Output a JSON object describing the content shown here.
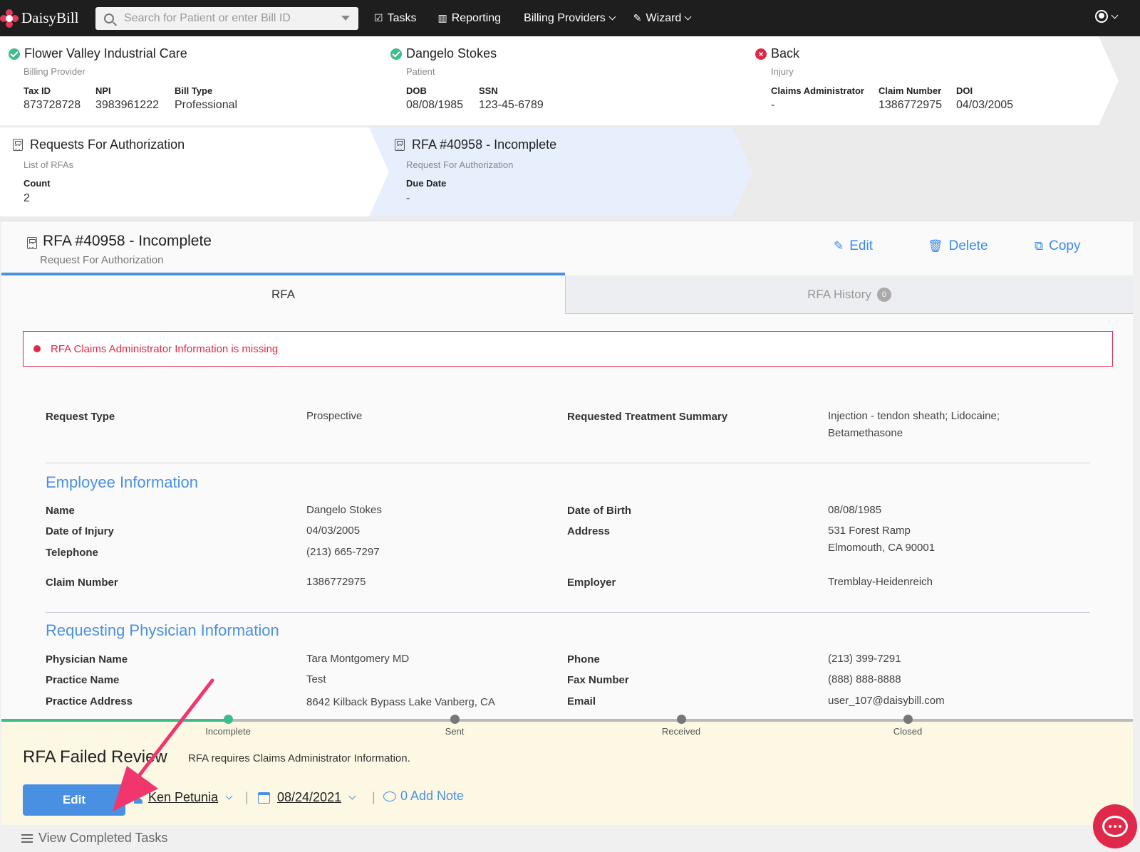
{
  "nav": {
    "brand": "DaisyBill",
    "search_placeholder": "Search for Patient or enter Bill ID",
    "tasks": "Tasks",
    "reporting": "Reporting",
    "billing_providers": "Billing Providers",
    "wizard": "Wizard"
  },
  "crumbs": {
    "provider": {
      "title": "Flower Valley Industrial Care",
      "sub": "Billing Provider",
      "fields": [
        {
          "label": "Tax ID",
          "value": "873728728"
        },
        {
          "label": "NPI",
          "value": "3983961222"
        },
        {
          "label": "Bill Type",
          "value": "Professional"
        }
      ]
    },
    "patient": {
      "title": "Dangelo Stokes",
      "sub": "Patient",
      "fields": [
        {
          "label": "DOB",
          "value": "08/08/1985"
        },
        {
          "label": "SSN",
          "value": "123-45-6789"
        }
      ]
    },
    "injury": {
      "title": "Back",
      "sub": "Injury",
      "fields": [
        {
          "label": "Claims Administrator",
          "value": "-"
        },
        {
          "label": "Claim Number",
          "value": "1386772975"
        },
        {
          "label": "DOI",
          "value": "04/03/2005"
        }
      ]
    },
    "rfas": {
      "title": "Requests For Authorization",
      "sub": "List of RFAs",
      "fields": [
        {
          "label": "Count",
          "value": "2"
        }
      ]
    },
    "rfa": {
      "title": "RFA #40958 - Incomplete",
      "sub": "Request For Authorization",
      "fields": [
        {
          "label": "Due Date",
          "value": "-"
        }
      ]
    }
  },
  "main": {
    "title": "RFA #40958 - Incomplete",
    "sub": "Request For Authorization",
    "actions": {
      "edit": "Edit",
      "delete": "Delete",
      "copy": "Copy"
    },
    "tabs": {
      "rfa": "RFA",
      "history": "RFA History",
      "history_count": "0"
    },
    "alert": "RFA Claims Administrator Information is missing",
    "request": {
      "type_label": "Request Type",
      "type_value": "Prospective",
      "summary_label": "Requested Treatment Summary",
      "summary_line1": "Injection - tendon sheath; Lidocaine;",
      "summary_line2": "Betamethasone"
    },
    "employee": {
      "heading": "Employee Information",
      "name_label": "Name",
      "name_value": "Dangelo Stokes",
      "doi_label": "Date of Injury",
      "doi_value": "04/03/2005",
      "phone_label": "Telephone",
      "phone_value": "(213) 665-7297",
      "claim_label": "Claim Number",
      "claim_value": "1386772975",
      "dob_label": "Date of Birth",
      "dob_value": "08/08/1985",
      "address_label": "Address",
      "address_line1": "531 Forest Ramp",
      "address_line2": "Elmomouth, CA 90001",
      "employer_label": "Employer",
      "employer_value": "Tremblay-Heidenreich"
    },
    "physician": {
      "heading": "Requesting Physician Information",
      "name_label": "Physician Name",
      "name_value": "Tara Montgomery MD",
      "practice_label": "Practice Name",
      "practice_value": "Test",
      "address_label": "Practice Address",
      "address_value": "8642 Kilback Bypass Lake Vanberg, CA",
      "phone_label": "Phone",
      "phone_value": "(213) 399-7291",
      "fax_label": "Fax Number",
      "fax_value": "(888) 888-8888",
      "email_label": "Email",
      "email_value": "user_107@daisybill.com"
    }
  },
  "status": {
    "steps": [
      "Incomplete",
      "Sent",
      "Received",
      "Closed"
    ],
    "title": "RFA Failed Review",
    "message": "RFA requires Claims Administrator Information.",
    "edit": "Edit",
    "assignee": "Ken Petunia",
    "due": "08/24/2021",
    "note": "0 Add Note",
    "completed": "View Completed Tasks"
  }
}
